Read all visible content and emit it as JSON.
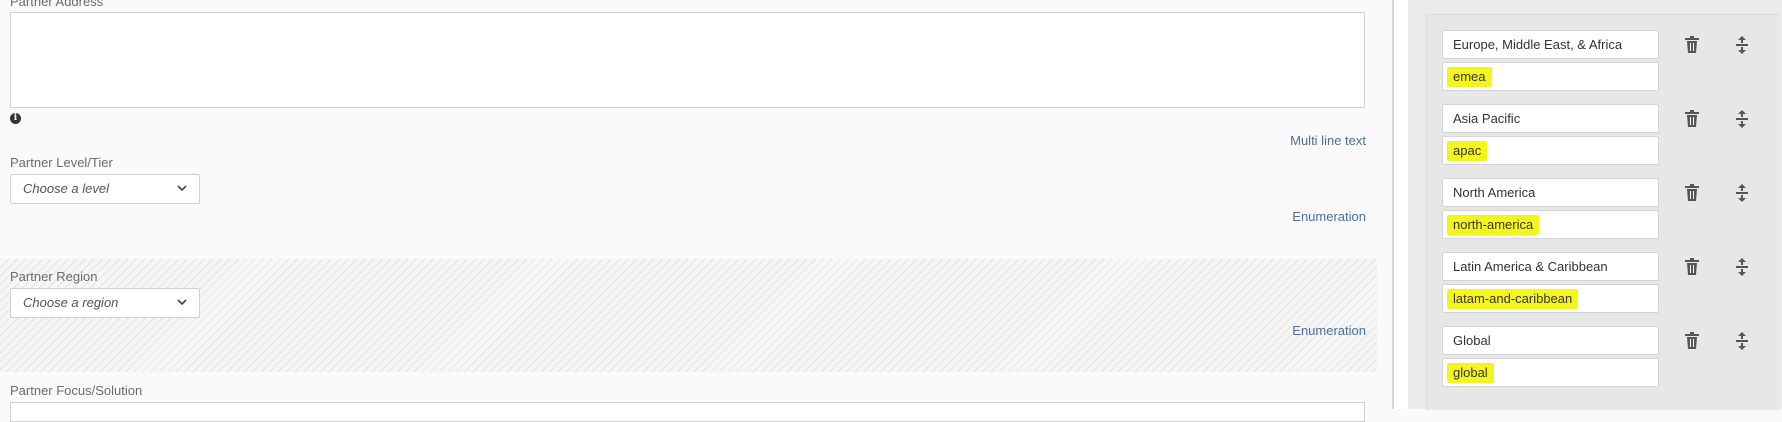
{
  "fields": {
    "address": {
      "label": "Partner Address",
      "type_label": "Multi line text",
      "info_icon": "info-icon"
    },
    "level": {
      "label": "Partner Level/Tier",
      "placeholder": "Choose a level",
      "type_label": "Enumeration"
    },
    "region": {
      "label": "Partner Region",
      "placeholder": "Choose a region",
      "type_label": "Enumeration"
    },
    "focus": {
      "label": "Partner Focus/Solution"
    }
  },
  "options": [
    {
      "name": "Europe, Middle East, & Africa",
      "value": "emea"
    },
    {
      "name": "Asia Pacific",
      "value": "apac"
    },
    {
      "name": "North America",
      "value": "north-america"
    },
    {
      "name": "Latin America & Caribbean",
      "value": "latam-and-caribbean"
    },
    {
      "name": "Global",
      "value": "global"
    }
  ],
  "icons": {
    "delete": "trash-icon",
    "reorder": "drag-handle-icon",
    "dropdown": "chevron-down-icon"
  },
  "colors": {
    "highlight": "#f5f51e",
    "link": "#4a6fa5"
  }
}
